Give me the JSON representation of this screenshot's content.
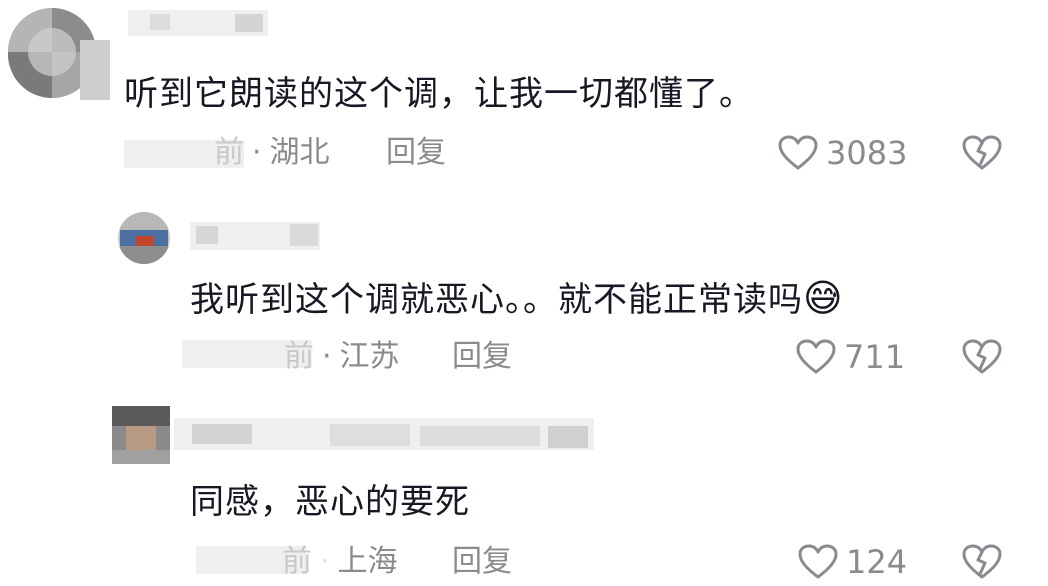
{
  "comments": [
    {
      "text": "听到它朗读的这个调，让我一切都懂了。",
      "time_suffix": "前",
      "location": "湖北",
      "reply_label": "回复",
      "likes": "3083"
    },
    {
      "text": "我听到这个调就恶心。。就不能正常读吗",
      "emoji": "😅",
      "time_suffix": "前",
      "location": "江苏",
      "reply_label": "回复",
      "likes": "711"
    },
    {
      "text": "同感，恶心的要死",
      "time_suffix": "前",
      "location": "上海",
      "reply_label": "回复",
      "likes": "124"
    }
  ],
  "icons": {
    "like": "heart-outline-icon",
    "dislike": "broken-heart-icon"
  },
  "colors": {
    "text": "#161823",
    "meta": "#8a8b91",
    "background": "#ffffff"
  }
}
